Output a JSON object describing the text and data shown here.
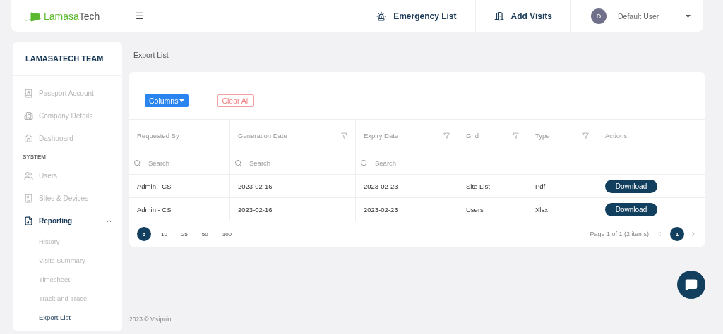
{
  "header": {
    "logo": {
      "first": "Lamasa",
      "second": "Tech"
    },
    "menu_icon": "☰",
    "links": [
      {
        "kind": "siren",
        "label": "Emergency List"
      },
      {
        "kind": "door",
        "label": "Add Visits"
      }
    ],
    "user": {
      "initial": "D",
      "name": "Default User"
    }
  },
  "sidebar": {
    "title": "LAMASATECH TEAM",
    "items": [
      {
        "kind": "item",
        "label": "Passport Account",
        "selected": false
      },
      {
        "kind": "item",
        "label": "Company Details",
        "selected": false
      },
      {
        "kind": "item",
        "label": "Dashboard",
        "selected": false
      },
      {
        "kind": "section",
        "label": "SYSTEM"
      },
      {
        "kind": "item",
        "label": "Users",
        "selected": false
      },
      {
        "kind": "item",
        "label": "Sites & Devices",
        "selected": false
      },
      {
        "kind": "group",
        "label": "Reporting",
        "selected": true,
        "expanded": true,
        "children": [
          {
            "label": "History",
            "selected": false
          },
          {
            "label": "Visits Summary",
            "selected": false
          },
          {
            "label": "Timesheet",
            "selected": false
          },
          {
            "label": "Track and Trace",
            "selected": false
          },
          {
            "label": "Export List",
            "selected": true
          }
        ]
      }
    ]
  },
  "breadcrumb": "Export List",
  "toolbar": {
    "columns_button": "Columns",
    "clear_button": "Clear All"
  },
  "table": {
    "columns": [
      {
        "label": "Requested By",
        "filter": false
      },
      {
        "label": "Generation Date",
        "filter": true
      },
      {
        "label": "Expiry Date",
        "filter": true
      },
      {
        "label": "Grid",
        "filter": true
      },
      {
        "label": "Type",
        "filter": true
      },
      {
        "label": "Actions",
        "filter": false
      }
    ],
    "search_fields": [
      {
        "placeholder": "Search"
      },
      {
        "placeholder": "Search"
      },
      {
        "placeholder": "Search"
      }
    ],
    "rows": [
      {
        "requested_by": "Admin - CS",
        "generation_date": "2023-02-16",
        "expiry_date": "2023-02-23",
        "grid": "Site List",
        "type": "Pdf",
        "action": "Download"
      },
      {
        "requested_by": "Admin - CS",
        "generation_date": "2023-02-16",
        "expiry_date": "2023-02-23",
        "grid": "Users",
        "type": "Xlsx",
        "action": "Download"
      }
    ]
  },
  "pager": {
    "page_sizes": [
      {
        "label": "5",
        "selected": true
      },
      {
        "label": "10",
        "selected": false
      },
      {
        "label": "25",
        "selected": false
      },
      {
        "label": "50",
        "selected": false
      },
      {
        "label": "100",
        "selected": false
      }
    ],
    "info": "Page 1 of 1 (2 items)",
    "pages": [
      {
        "label": "1",
        "selected": true
      }
    ]
  },
  "footer": "2023 © Visipoint."
}
